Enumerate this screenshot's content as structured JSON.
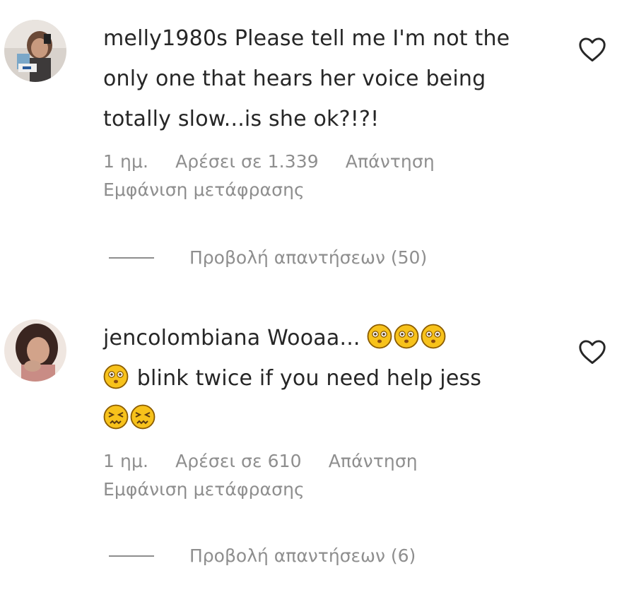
{
  "comments": [
    {
      "username": "melly1980s",
      "text": "Please tell me I'm not the only one that hears her voice being totally slow...is she ok?!?!",
      "time": "1 ημ.",
      "likes": "Αρέσει σε 1.339",
      "reply_label": "Απάντηση",
      "translate_label": "Εμφάνιση μετάφρασης",
      "view_replies_label": "Προβολή απαντήσεων (50)",
      "like_icon": "heart-outline-icon"
    },
    {
      "username": "jencolombiana",
      "text_part1": "Wooaa...",
      "text_part2": "blink twice if you need help jess",
      "emoji_flushed": "flushed-face-emoji",
      "emoji_confounded": "confounded-face-emoji",
      "time": "1 ημ.",
      "likes": "Αρέσει σε 610",
      "reply_label": "Απάντηση",
      "translate_label": "Εμφάνιση μετάφρασης",
      "view_replies_label": "Προβολή απαντήσεων (6)",
      "like_icon": "heart-outline-icon"
    }
  ],
  "colors": {
    "primary_text": "#262626",
    "secondary_text": "#8e8e8e",
    "emoji_yellow": "#f7c21b"
  }
}
